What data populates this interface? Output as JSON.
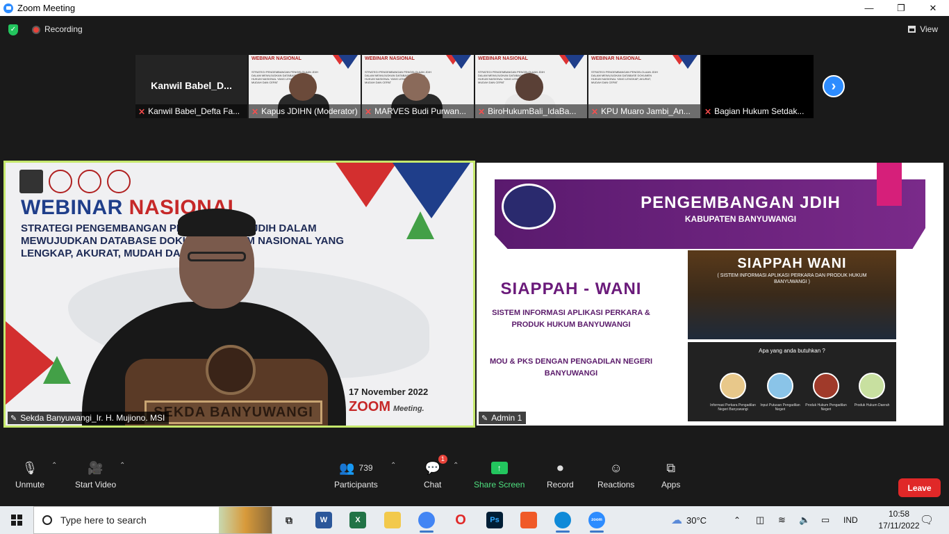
{
  "window": {
    "title": "Zoom Meeting",
    "controls": [
      "—",
      "❐",
      "✕"
    ]
  },
  "topbar": {
    "recording_label": "Recording",
    "view_label": "View"
  },
  "participants_strip": [
    {
      "big_name": "Kanwil  Babel_D...",
      "caption": "Kanwil Babel_Defta Fa..."
    },
    {
      "caption": "Kapus JDIHN (Moderator)"
    },
    {
      "caption": "MARVES Budi Purwan..."
    },
    {
      "caption": "BiroHukumBali_IdaBa..."
    },
    {
      "caption": "KPU Muaro Jambi_An..."
    },
    {
      "caption": "Bagian Hukum Setdak..."
    }
  ],
  "thumb_banner": {
    "title": "WEBINAR NASIONAL",
    "text": "STRATEGI PENGEMBANGAN PENGELOLAAN JDIH DALAM MEWUJUDKAN DATABASE DOKUMEN HUKUM NASIONAL YANG LENGKAP, AKURAT, MUDAH DAN CEPAT"
  },
  "speaker": {
    "name_label": "Sekda Banyuwangi_Ir. H. Mujiono. MSI",
    "title_a": "WEBINAR ",
    "title_b": "NASIONAL",
    "subtitle": "STRATEGI PENGEMBANGAN PENGELOLAAN JDIH DALAM MEWUJUDKAN DATABASE DOKUMEN HUKUM NASIONAL YANG LENGKAP, AKURAT, MUDAH DAN CEPAT",
    "date": "17 November 2022",
    "zoom_text": "ZOOM",
    "meeting_text": "Meeting.",
    "podium_sign": "SEKDA BANYUWANGI"
  },
  "shared_screen": {
    "name_label": "Admin 1",
    "banner_title": "PENGEMBANGAN JDIH",
    "banner_sub": "KABUPATEN BANYUWANGI",
    "left_title": "SIAPPAH - WANI",
    "left_sub": "SISTEM INFORMASI APLIKASI PERKARA & PRODUK HUKUM BANYUWANGI",
    "left_mou": "MOU & PKS DENGAN PENGADILAN NEGERI BANYUWANGI",
    "img_title": "SIAPPAH WANI",
    "img_sub": "( SISTEM INFORMASI APLIKASI PERKARA DAN PRODUK HUKUM BANYUWANGI )",
    "img2_question": "Apa yang anda butuhkan ?",
    "img2_items": [
      "Informasi Perkara Pengadilan Negeri Banyuwangi",
      "Input Putusan Pengadilan Negeri",
      "Produk Hukum Pengadilan Negeri",
      "Produk Hukum Daerah"
    ]
  },
  "toolbar": {
    "unmute": "Unmute",
    "start_video": "Start Video",
    "participants": "Participants",
    "participants_count": "739",
    "chat": "Chat",
    "chat_badge": "1",
    "share_screen": "Share Screen",
    "record": "Record",
    "reactions": "Reactions",
    "apps": "Apps",
    "leave": "Leave"
  },
  "taskbar": {
    "search_placeholder": "Type here to search",
    "temperature": "30°C",
    "language": "IND",
    "time": "10:58",
    "date": "17/11/2022"
  },
  "colors": {
    "zoom_blue": "#2d8cff",
    "share_green": "#23c55e",
    "leave_red": "#e02828",
    "active_speaker_border": "#c5e86c"
  }
}
